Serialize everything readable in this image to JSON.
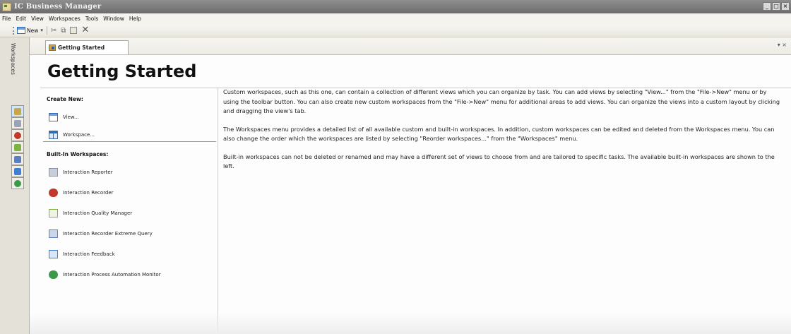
{
  "window": {
    "title": "IC Business Manager",
    "controls": [
      "_",
      "□",
      "×"
    ]
  },
  "menu": [
    "File",
    "Edit",
    "View",
    "Workspaces",
    "Tools",
    "Window",
    "Help"
  ],
  "toolbar": {
    "new_label": "New",
    "dropdown_glyph": "▾",
    "cut_glyph": "✂",
    "copy_glyph": "⧉",
    "paste_glyph": "📋",
    "delete_glyph": "✕"
  },
  "workspaces_strip": {
    "label": "Workspaces",
    "icons": [
      {
        "name": "getting-started-icon",
        "color": "#c9a64a"
      },
      {
        "name": "interaction-reporter-icon",
        "color": "#9aa4b8"
      },
      {
        "name": "interaction-recorder-icon",
        "color": "#c0392b"
      },
      {
        "name": "interaction-quality-manager-icon",
        "color": "#7cb342"
      },
      {
        "name": "interaction-recorder-extreme-query-icon",
        "color": "#5b7fbf"
      },
      {
        "name": "interaction-feedback-icon",
        "color": "#3f7fd0"
      },
      {
        "name": "interaction-process-automation-monitor-icon",
        "color": "#3a9a4a"
      }
    ]
  },
  "tab": {
    "label": "Getting Started",
    "controls": "▾ ×"
  },
  "page": {
    "title": "Getting Started",
    "create_new": {
      "heading": "Create New:",
      "items": [
        {
          "label": "View...",
          "icon": "view-icon"
        },
        {
          "label": "Workspace...",
          "icon": "workspace-icon"
        }
      ]
    },
    "built_in": {
      "heading": "Built-In Workspaces:",
      "items": [
        {
          "label": "Interaction Reporter",
          "icon": "report-icon",
          "color": "#9aa4b8"
        },
        {
          "label": "Interaction Recorder",
          "icon": "recorder-icon",
          "color": "#c0392b"
        },
        {
          "label": "Interaction Quality Manager",
          "icon": "quality-icon",
          "color": "#7cb342"
        },
        {
          "label": "Interaction Recorder Extreme Query",
          "icon": "query-icon",
          "color": "#5b7fbf"
        },
        {
          "label": "Interaction Feedback",
          "icon": "feedback-icon",
          "color": "#3f7fd0"
        },
        {
          "label": "Interaction Process Automation Monitor",
          "icon": "automation-icon",
          "color": "#3a9a4a"
        }
      ]
    },
    "paragraphs": [
      "Custom workspaces, such as this one, can contain a collection of different views which you can organize by task. You can add views by selecting \"View...\" from the \"File->New\" menu or by using the toolbar button. You can also create new custom workspaces from the \"File->New\" menu for additional areas to add views. You can organize the views into a custom layout by clicking and dragging the view's tab.",
      "The Workspaces menu provides a detailed list of all available custom and built-in workspaces. In addition, custom workspaces can be edited and deleted from the Workspaces menu. You can also change the order which the workspaces are listed by selecting \"Reorder workspaces...\" from the \"Workspaces\" menu.",
      "Built-in workspaces can not be deleted or renamed and may have a different set of views to choose from and are tailored to specific tasks. The available built-in workspaces are shown to the left."
    ]
  }
}
